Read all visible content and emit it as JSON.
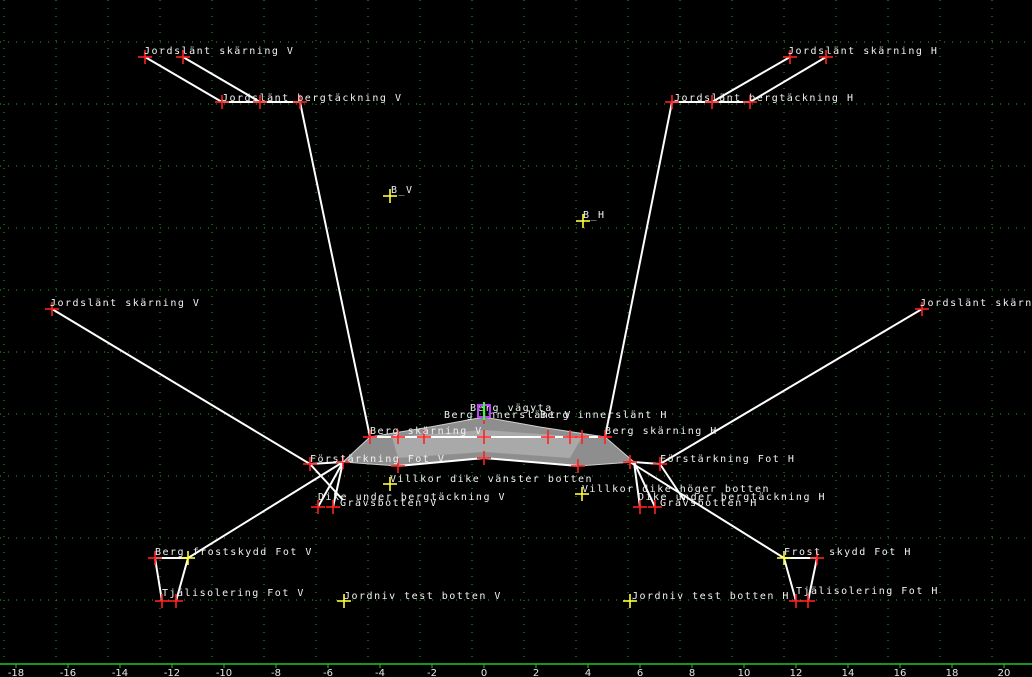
{
  "colors": {
    "background": "#000000",
    "grid": "#1db51d",
    "axis": "#22c322",
    "section_lines": "#ffffff",
    "point_marker": "#ff2020",
    "helper_marker": "#ffff33",
    "center_marker": "#c040ff"
  },
  "axis": {
    "ticks": [
      "-18",
      "-16",
      "-14",
      "-12",
      "-10",
      "-8",
      "-6",
      "-4",
      "-2",
      "0",
      "2",
      "4",
      "6",
      "8",
      "10",
      "12",
      "14",
      "16",
      "18",
      "20"
    ]
  },
  "labels": {
    "jord_skarning_v_top": "Jordslänt skärning V",
    "jord_skarning_h_top": "Jordslänt skärning H",
    "jord_berg_v": "Jordslänt bergtäckning V",
    "jord_berg_h": "Jordslänt bergtäckning H",
    "b_v": "B_V",
    "b_h": "B_H",
    "jord_v_mid": "Jordslänt skärning V",
    "jord_h_mid": "Jordslänt skärning H",
    "berg_vagyta": "Berg vägyta",
    "berg_skarning_v": "Berg skärning V",
    "berg_skarning_h": "Berg skärning H",
    "berg_inner_v": "Berg innerslänt V",
    "berg_inner_h": "Berg innerslänt H",
    "forst_v": "Förstärkning Fot V",
    "forst_h": "Förstärkning Fot H",
    "villkor_v": "Villkor dike vänster botten",
    "villkor_h": "Villkor dike höger botten",
    "dike_v": "Dike under bergtäckning V",
    "dike_h": "Dike under bergtäckning H",
    "tjale_v": "Tjälisolering Fot V",
    "tjale_h": "Tjälisolering Fot H",
    "grav_v": "Gravsbotten V",
    "grav_h": "Gravsbotten H",
    "jordniv_v": "Jordniv test botten V",
    "jordniv_h": "Jordniv test botten H",
    "frost_h": "Frost skydd Fot H",
    "berg_frost_v": "Berg frostskydd Fot V"
  }
}
